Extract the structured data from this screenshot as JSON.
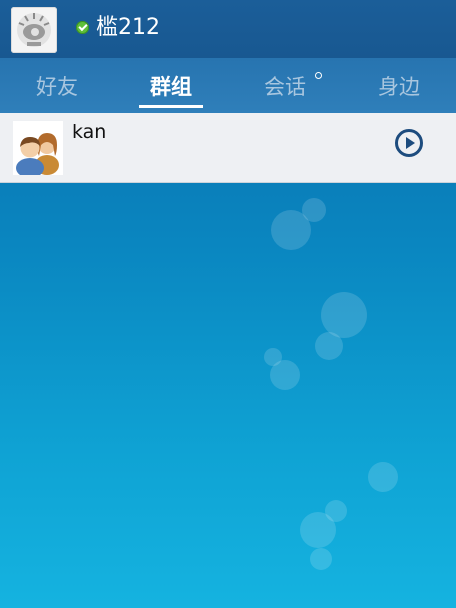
{
  "header": {
    "avatar_icon": "sina-eye-logo-icon",
    "status_icon": "online-check-icon",
    "username": "槛212"
  },
  "tabs": [
    {
      "label": "好友",
      "active": false
    },
    {
      "label": "群组",
      "active": true
    },
    {
      "label": "会话",
      "active": false,
      "has_notification_dot": true
    },
    {
      "label": "身边",
      "active": false
    }
  ],
  "groups": [
    {
      "name": "kan",
      "avatar_icon": "group-people-icon",
      "action_icon": "play-arrow-icon"
    }
  ],
  "colors": {
    "header_bg": "#1b5e99",
    "tabs_bg": "#2a78b4",
    "row_bg": "#eef0f3",
    "accent": "#1d4c7e",
    "online": "#5fbf3a"
  }
}
